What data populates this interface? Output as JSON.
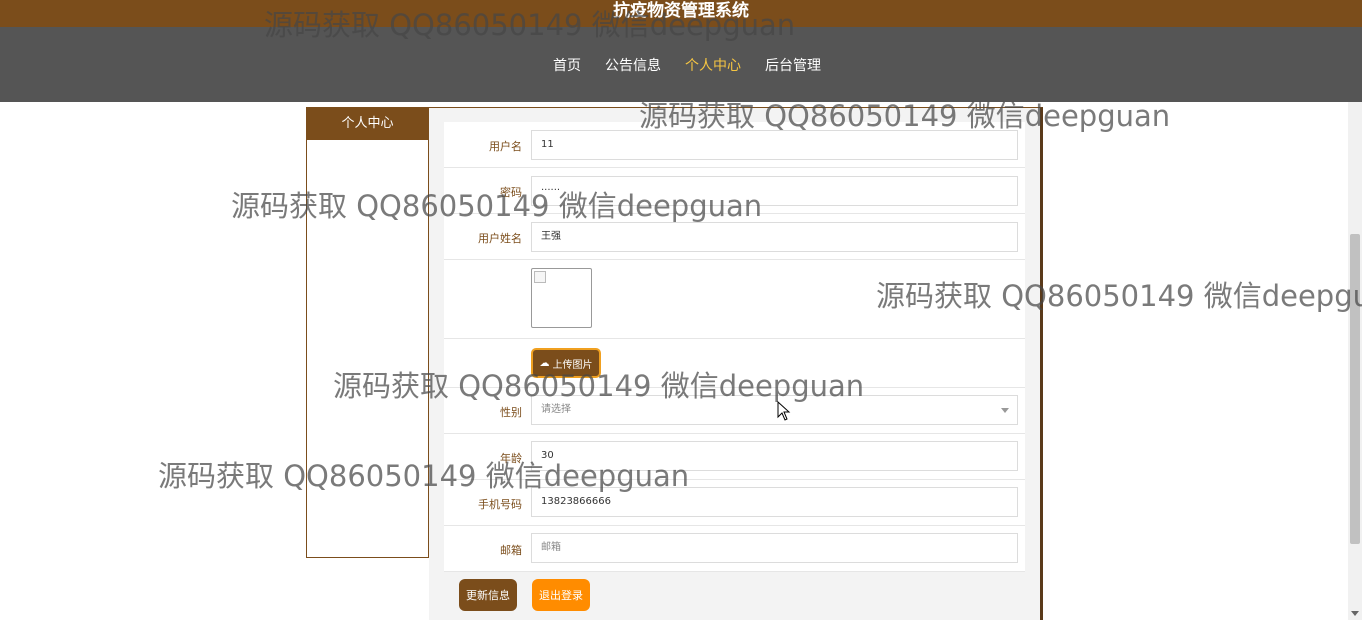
{
  "site": {
    "title": "抗疫物资管理系统"
  },
  "nav": {
    "items": [
      "首页",
      "公告信息",
      "个人中心",
      "后台管理"
    ],
    "active_index": 2
  },
  "sidebar": {
    "title": "个人中心"
  },
  "form": {
    "username_label": "用户名",
    "username_value": "11",
    "password_label": "密码",
    "password_value": "······",
    "realname_label": "用户姓名",
    "realname_value": "王强",
    "upload_label": "上传图片",
    "gender_label": "性别",
    "gender_placeholder": "请选择",
    "age_label": "年龄",
    "age_value": "30",
    "phone_label": "手机号码",
    "phone_value": "13823866666",
    "email_label": "邮箱",
    "email_placeholder": "邮箱"
  },
  "buttons": {
    "update": "更新信息",
    "logout": "退出登录"
  },
  "watermarks": [
    "源码获取 QQ86050149 微信deepguan",
    "源码获取 QQ86050149 微信deepguan",
    "源码获取 QQ86050149 微信deepguan",
    "源码获取 QQ86050149 微信deepgu",
    "源码获取 QQ86050149 微信deepguan",
    "源码获取 QQ86050149 微信deepguan"
  ],
  "colors": {
    "brand": "#7b4d1b",
    "nav_bg": "#555555",
    "active": "#f5c542",
    "logout": "#ff8c00"
  }
}
